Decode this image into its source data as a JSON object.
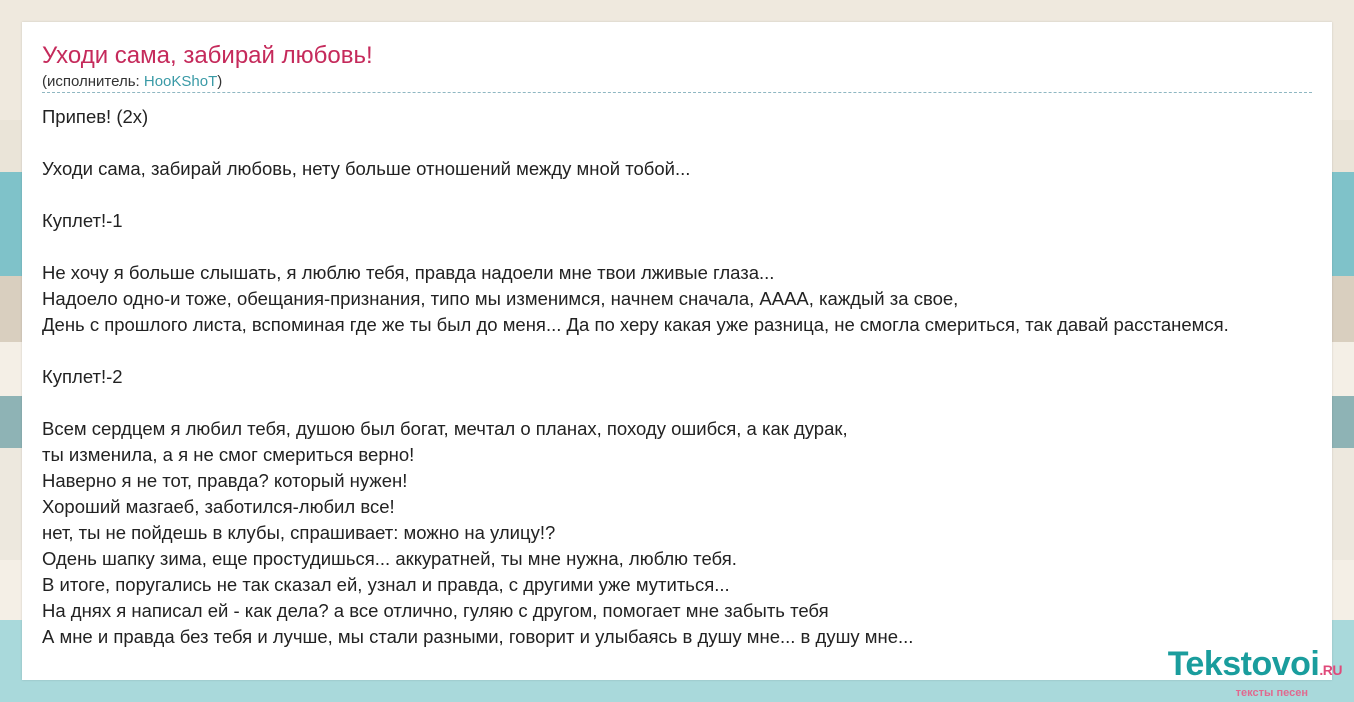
{
  "colors": {
    "stripes": [
      "#efe9de",
      "#eae4d8",
      "#7fc2c9",
      "#d9cfbf",
      "#f4efe6",
      "#8eb3b5",
      "#ede8de",
      "#a9d9db",
      "#f2ede4"
    ],
    "title": "#c52a5b",
    "link": "#3a9aa6",
    "logo": "#1a9d9d",
    "logo_accent": "#e04a7a"
  },
  "song": {
    "title": "Уходи сама, забирай любовь!",
    "artist_prefix": "(исполнитель: ",
    "artist": "HooKShoT",
    "artist_suffix": ")"
  },
  "lyrics": [
    "Припев! (2x)",
    "",
    "Уходи сама, забирай любовь, нету больше отношений между мной тобой...",
    "",
    "Куплет!-1",
    "",
    "Не хочу я больше слышать, я люблю тебя, правда надоели мне твои лживые глаза...",
    "Надоело одно-и тоже, обещания-признания, типо мы изменимся, начнем сначала, АААА, каждый за свое,",
    "День с прошлого листа, вспоминая где же ты был до меня... Да по херу какая уже разница, не смогла смериться, так давай расстанемся.",
    "",
    "Куплет!-2",
    "",
    "Всем сердцем я любил тебя, душою был богат, мечтал о планах, походу ошибся, а как дурак,",
    "ты изменила, а я не смог смериться верно!",
    "Наверно я не тот, правда? который нужен!",
    "Хороший мазгаеб, заботился-любил все!",
    "нет, ты не пойдешь в клубы, спрашивает: можно на улицу!?",
    "Одень шапку зима, еще простудишься... аккуратней, ты мне нужна, люблю тебя.",
    "В итоге, поругались не так сказал ей, узнал и правда, с другими уже мутиться...",
    "На днях я написал ей - как дела? а все отлично, гуляю с другом, помогает мне забыть тебя",
    "А мне и правда без тебя и лучше, мы стали разными, говорит и улыбаясь в душу мне... в душу мне..."
  ],
  "logo": {
    "name": "Tekstovoi",
    "suffix": ".RU",
    "tagline": "тексты песен"
  }
}
